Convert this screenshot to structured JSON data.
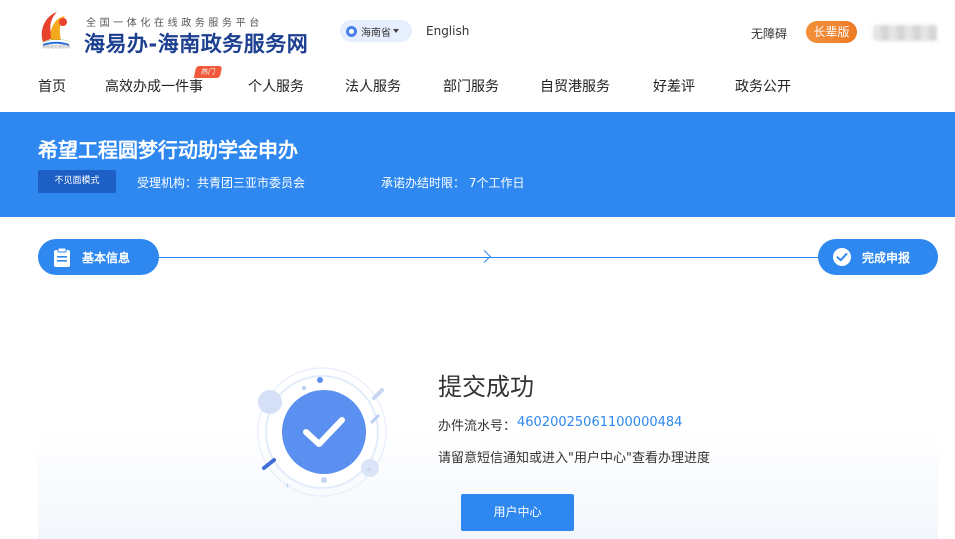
{
  "header": {
    "tagline": "全国一体化在线政务服务平台",
    "site_title": "海易办-海南政务服务网",
    "logo_small_text": "海南政务服务网",
    "region": "海南省",
    "language_link": "English",
    "accessibility_link": "无障碍",
    "elder_mode_button": "长辈版"
  },
  "nav": {
    "items": [
      {
        "label": "首页"
      },
      {
        "label": "高效办成一件事"
      },
      {
        "label": "个人服务"
      },
      {
        "label": "法人服务"
      },
      {
        "label": "部门服务"
      },
      {
        "label": "自贸港服务"
      },
      {
        "label": "好差评"
      },
      {
        "label": "政务公开"
      }
    ],
    "hot_badge": "热门"
  },
  "banner": {
    "title": "希望工程圆梦行动助学金申办",
    "mode_tag": "不见面模式",
    "agency": "受理机构：共青团三亚市委员会",
    "deadline": "承诺办结时限： 7个工作日"
  },
  "steps": [
    {
      "label": "基本信息"
    },
    {
      "label": "完成申报"
    }
  ],
  "result": {
    "title": "提交成功",
    "serial_label": "办件流水号：",
    "serial_value": "46020025061100000484",
    "tip": "请留意短信通知或进入\"用户中心\"查看办理进度",
    "user_center_button": "用户中心"
  },
  "colors": {
    "primary": "#2e88f0",
    "banner_tag": "#1d5fc4",
    "elder_button": "#ed7a25",
    "hot_badge": "#f05a3a",
    "site_title": "#1c3f8f"
  }
}
